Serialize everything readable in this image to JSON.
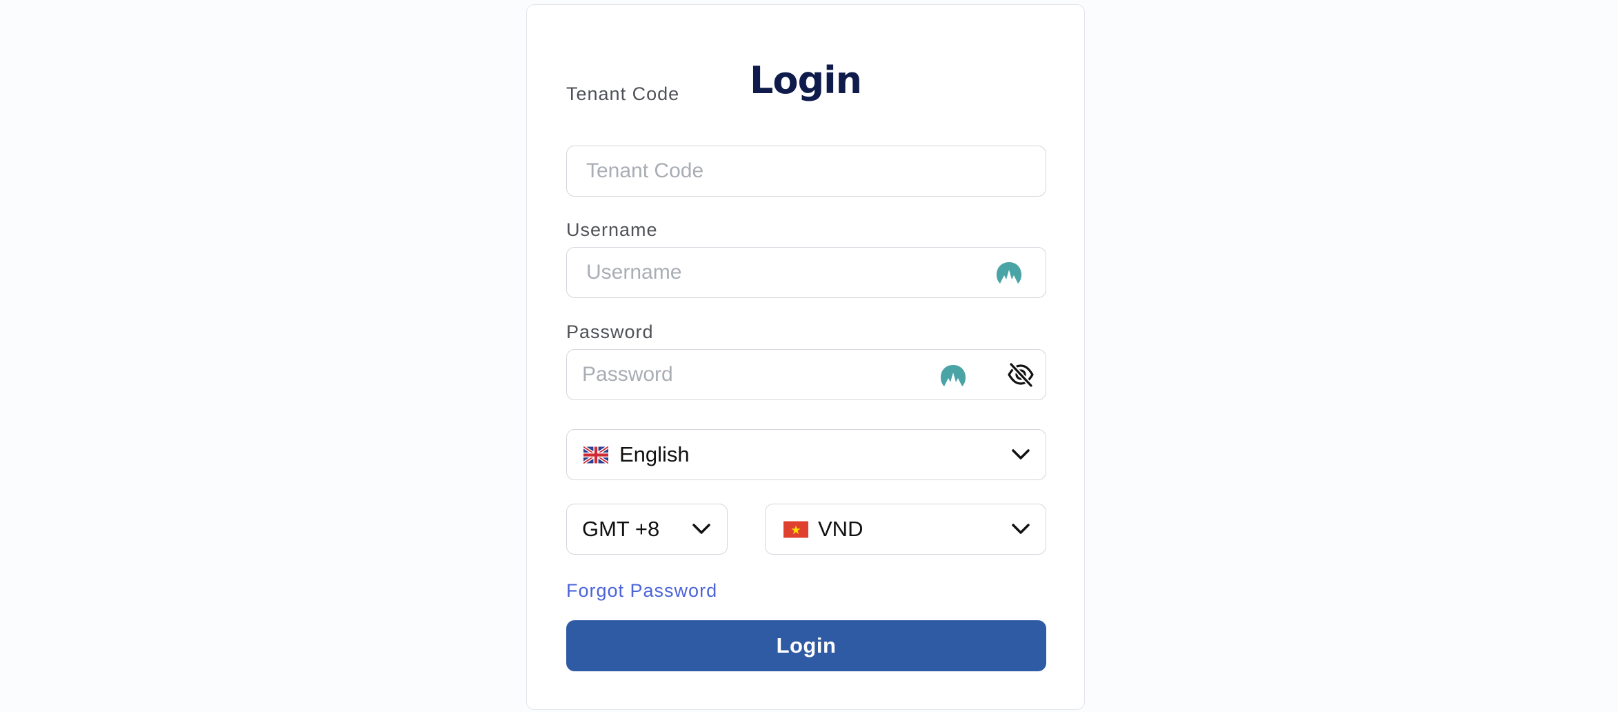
{
  "login_form": {
    "title": "Login",
    "tenant_code": {
      "label": "Tenant Code",
      "placeholder": "Tenant Code",
      "value": ""
    },
    "username": {
      "label": "Username",
      "placeholder": "Username",
      "value": ""
    },
    "password": {
      "label": "Password",
      "placeholder": "Password",
      "value": ""
    },
    "language": {
      "selected": "English",
      "flag_icon": "uk-flag-icon"
    },
    "timezone": {
      "selected": "GMT +8"
    },
    "currency": {
      "selected": "VND",
      "flag_icon": "vietnam-flag-icon"
    },
    "forgot_password": "Forgot Password",
    "submit_label": "Login"
  },
  "colors": {
    "title": "#0f1b4a",
    "primary_button": "#2f5ba5",
    "link": "#4a63d8",
    "vpn_icon": "#4aa3a5"
  }
}
